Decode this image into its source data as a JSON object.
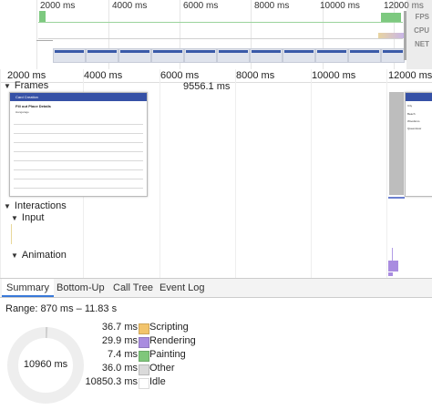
{
  "overview": {
    "ticks": [
      "2000 ms",
      "4000 ms",
      "6000 ms",
      "8000 ms",
      "10000 ms",
      "12000 ms"
    ],
    "side_labels": [
      "FPS",
      "CPU",
      "NET"
    ]
  },
  "ruler": {
    "ticks": [
      "2000 ms",
      "4000 ms",
      "6000 ms",
      "8000 ms",
      "10000 ms",
      "12000 ms"
    ]
  },
  "tracks": {
    "frames_label": "Frames",
    "frame_duration": "9556.1 ms",
    "interactions_label": "Interactions",
    "input_label": "Input",
    "animation_label": "Animation"
  },
  "frame_thumb": {
    "header": "Card Creation",
    "title": "Fill out Place Details",
    "field_1": "Hangarage",
    "right_fields": [
      "City",
      "Beach",
      "Woodsmo",
      "Queenstow"
    ]
  },
  "tabs": [
    "Summary",
    "Bottom-Up",
    "Call Tree",
    "Event Log"
  ],
  "summary": {
    "range": "Range: 870 ms – 11.83 s",
    "total": "10960 ms",
    "items": [
      {
        "value": "36.7 ms",
        "name": "Scripting",
        "color": "#f2c46c"
      },
      {
        "value": "29.9 ms",
        "name": "Rendering",
        "color": "#a98ce0"
      },
      {
        "value": "7.4 ms",
        "name": "Painting",
        "color": "#7fc77b"
      },
      {
        "value": "36.0 ms",
        "name": "Other",
        "color": "#dadada"
      },
      {
        "value": "10850.3 ms",
        "name": "Idle",
        "color": "#ffffff"
      }
    ]
  }
}
